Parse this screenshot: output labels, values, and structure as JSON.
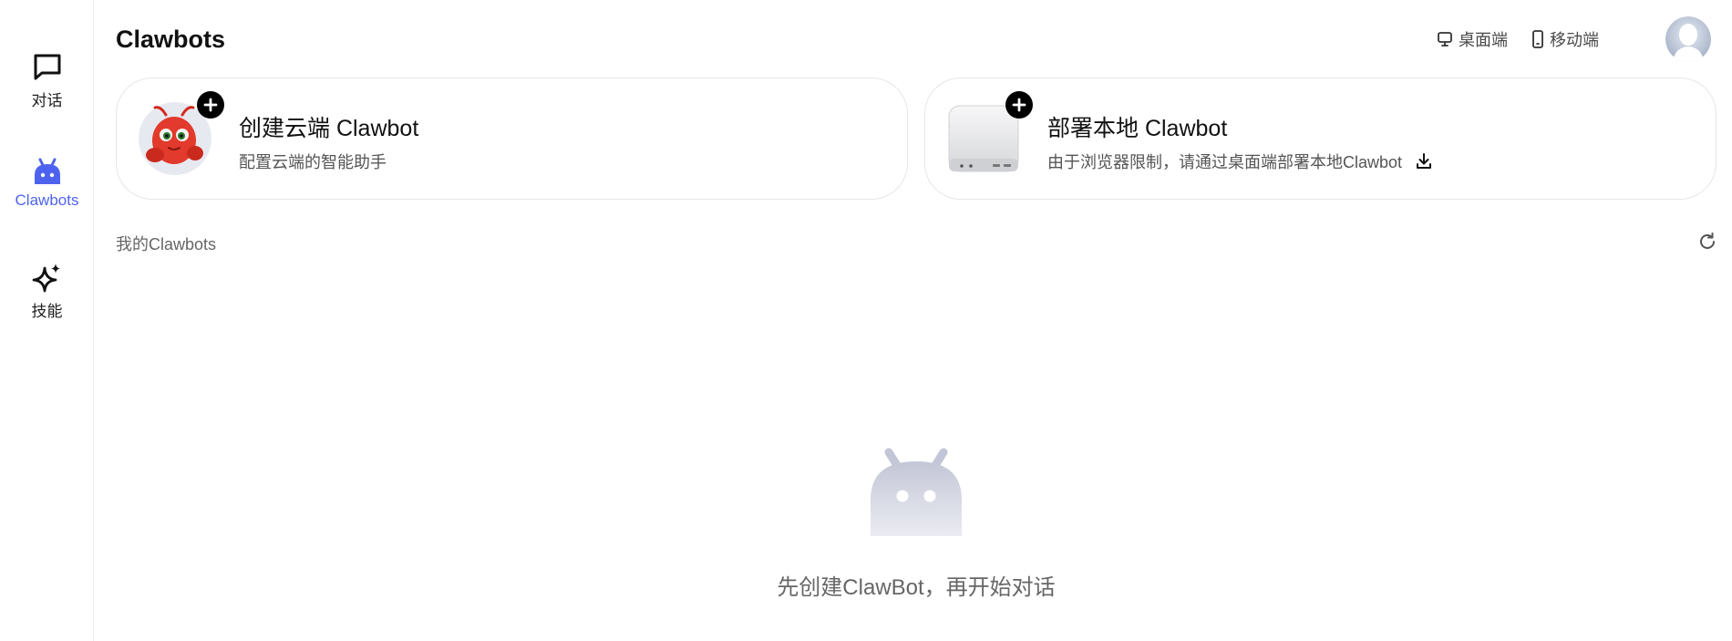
{
  "sidebar": {
    "items": [
      {
        "label": "对话",
        "icon": "chat-bubble-icon"
      },
      {
        "label": "Clawbots",
        "icon": "robot-icon",
        "active": true
      },
      {
        "label": "技能",
        "icon": "sparkle-icon"
      }
    ],
    "active_color": "#4d63f0"
  },
  "header": {
    "title": "Clawbots",
    "links": [
      {
        "label": "桌面端",
        "icon": "desktop-icon"
      },
      {
        "label": "移动端",
        "icon": "mobile-icon"
      }
    ]
  },
  "cards": {
    "cloud": {
      "title": "创建云端 Clawbot",
      "subtitle": "配置云端的智能助手",
      "icon": "lobster-mascot"
    },
    "local": {
      "title": "部署本地 Clawbot",
      "subtitle": "由于浏览器限制，请通过桌面端部署本地Clawbot",
      "icon": "mini-pc-device"
    }
  },
  "section": {
    "label": "我的Clawbots"
  },
  "empty_state": {
    "message": "先创建ClawBot，再开始对话"
  }
}
